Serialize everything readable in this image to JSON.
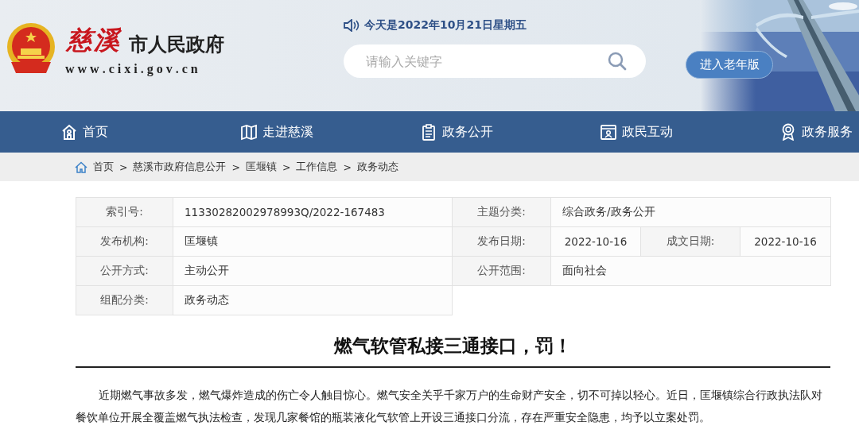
{
  "header": {
    "logo_calligraphy": "慈溪",
    "logo_title": "市人民政府",
    "logo_url": "w w w . c i x i . g o v . c n",
    "date": "今天是2022年10月21日星期五",
    "search": {
      "placeholder": "请输入关键字"
    },
    "elder_button": "进入老年版"
  },
  "nav": [
    {
      "label": "首页",
      "selected": false
    },
    {
      "label": "走进慈溪",
      "selected": false
    },
    {
      "label": "政务公开",
      "selected": false
    },
    {
      "label": "政民互动",
      "selected": false
    },
    {
      "label": "政务服务",
      "selected": false
    }
  ],
  "breadcrumb": {
    "separator": ">",
    "items": [
      "首页",
      "慈溪市政府信息公开",
      "匡堰镇",
      "工作信息",
      "政务动态"
    ]
  },
  "info_table": {
    "rows": [
      [
        {
          "label": "索引号:",
          "value": "11330282002978993Q/2022-167483"
        },
        {
          "label": "主题分类:",
          "value": "综合政务/政务公开"
        }
      ],
      [
        {
          "label": "发布机构:",
          "value": "匡堰镇"
        },
        {
          "label": "发布日期:",
          "value": "2022-10-16"
        },
        {
          "label": "成文日期:",
          "value": "2022-10-16"
        }
      ],
      [
        {
          "label": "公开方式:",
          "value": "主动公开"
        },
        {
          "label": "公开范围:",
          "value": "面向社会"
        }
      ],
      [
        {
          "label": "组配分类:",
          "value": "政务动态"
        }
      ]
    ]
  },
  "article": {
    "title": "燃气软管私接三通接口，罚！",
    "paragraphs": [
      "近期燃气事故多发，燃气爆炸造成的伤亡令人触目惊心。燃气安全关乎千家万户的生命财产安全，切不可掉以轻心。近日，匡堰镇综合行政执法队对餐饮单位开展全覆盖燃气执法检查，发现几家餐馆的瓶装液化气软管上开设三通接口分流，存在严重安全隐患，均予以立案处罚。"
    ]
  }
}
